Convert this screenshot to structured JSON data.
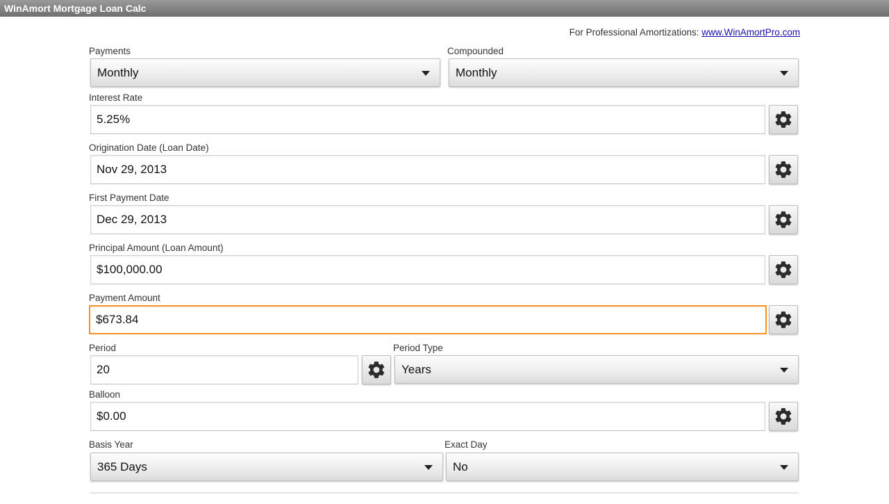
{
  "app": {
    "title": "WinAmort Mortgage Loan Calc"
  },
  "promo": {
    "text": "For Professional Amortizations: ",
    "link": "www.WinAmortPro.com"
  },
  "payments": {
    "label": "Payments",
    "value": "Monthly"
  },
  "compounded": {
    "label": "Compounded",
    "value": "Monthly"
  },
  "interest_rate": {
    "label": "Interest Rate",
    "value": "5.25%"
  },
  "origination_date": {
    "label": "Origination Date (Loan Date)",
    "value": "Nov 29, 2013"
  },
  "first_payment_date": {
    "label": "First Payment Date",
    "value": "Dec 29, 2013"
  },
  "principal": {
    "label": "Principal Amount (Loan Amount)",
    "value": "$100,000.00"
  },
  "payment_amount": {
    "label": "Payment Amount",
    "value": "$673.84"
  },
  "period": {
    "label": "Period",
    "value": "20"
  },
  "period_type": {
    "label": "Period Type",
    "value": "Years"
  },
  "balloon": {
    "label": "Balloon",
    "value": "$0.00"
  },
  "basis_year": {
    "label": "Basis Year",
    "value": "365 Days"
  },
  "exact_day": {
    "label": "Exact Day",
    "value": "No"
  },
  "icons": {
    "gear": "gear-icon",
    "dropdown": "chevron-down-icon"
  },
  "colors": {
    "focus_border": "#f7931e",
    "titlebar": "#7f7f7f",
    "link": "#1a0dab"
  }
}
